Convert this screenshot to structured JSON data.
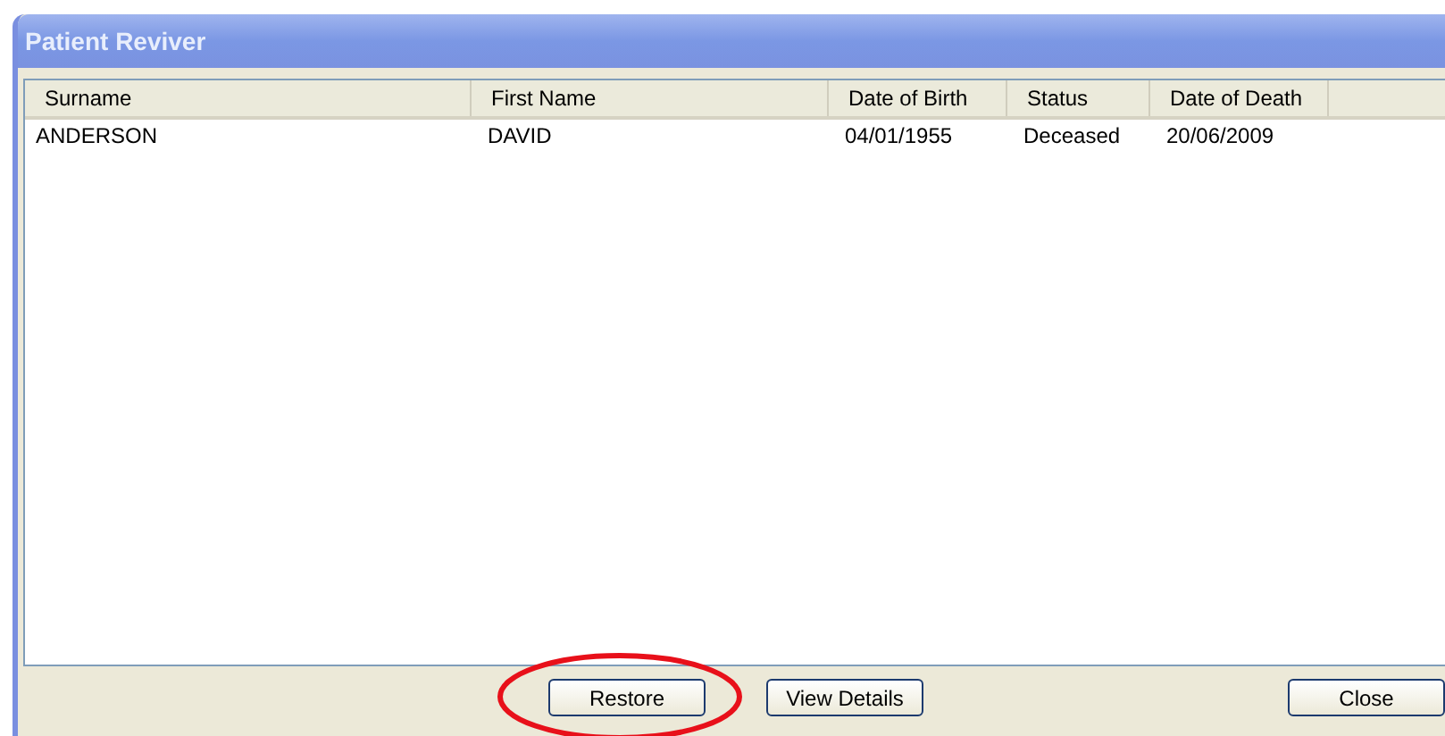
{
  "window": {
    "title": "Patient Reviver"
  },
  "table": {
    "columns": [
      "Surname",
      "First Name",
      "Date of Birth",
      "Status",
      "Date of Death"
    ],
    "rows": [
      {
        "cells": [
          "ANDERSON",
          "DAVID",
          "04/01/1955",
          "Deceased",
          "20/06/2009"
        ],
        "selected": false
      }
    ]
  },
  "buttons": [
    {
      "label": "Restore",
      "kind": "action",
      "highlighted": true
    },
    {
      "label": "View Details",
      "kind": "action",
      "highlighted": false
    },
    {
      "label": "Close",
      "kind": "dismiss",
      "highlighted": false
    }
  ]
}
